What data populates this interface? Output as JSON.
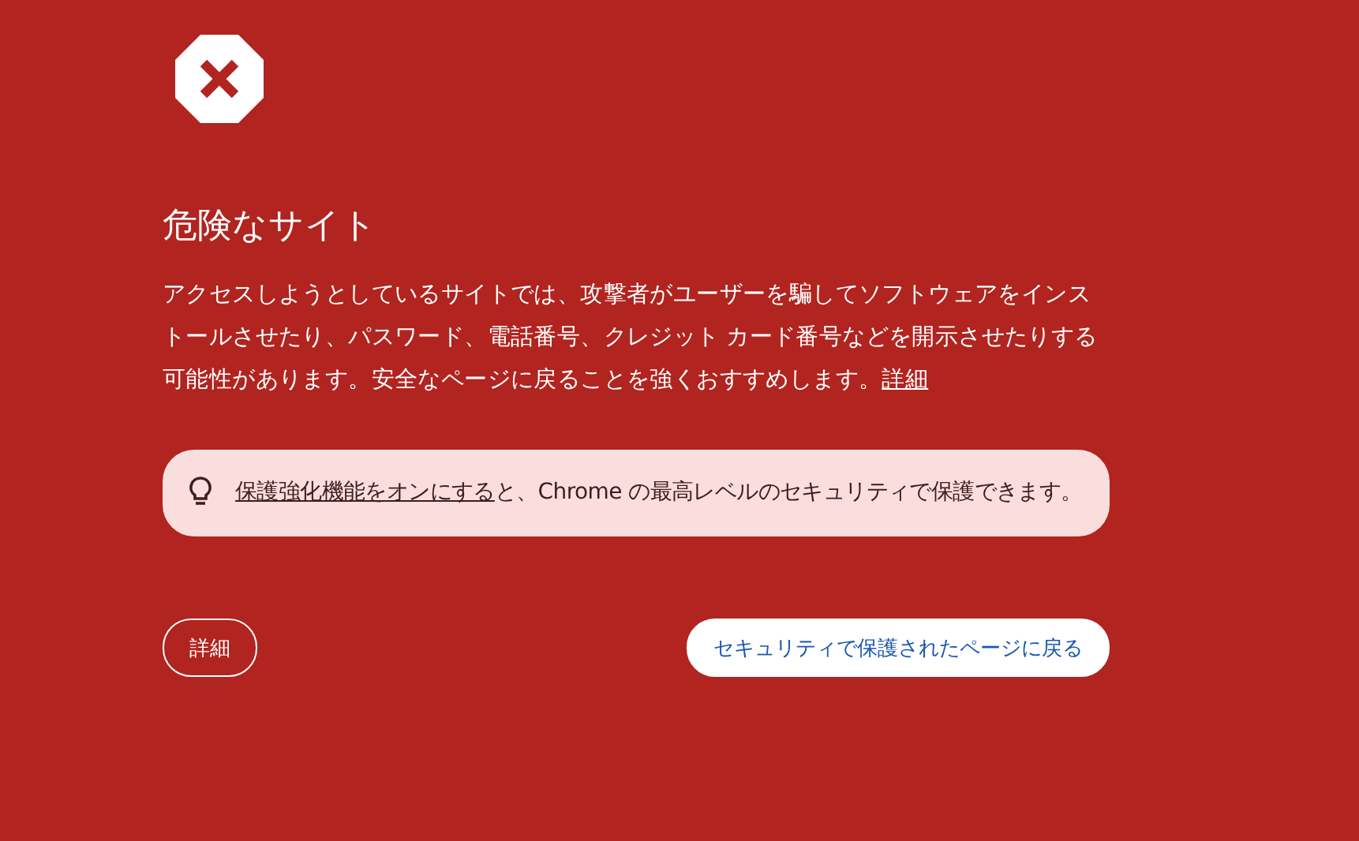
{
  "title": "危険なサイト",
  "description": {
    "text": "アクセスしようとしているサイトでは、攻撃者がユーザーを騙してソフトウェアをインストールさせたり、パスワード、電話番号、クレジット カード番号などを開示させたりする可能性があります。安全なページに戻ることを強くおすすめします。",
    "link": "詳細"
  },
  "tip": {
    "link": "保護強化機能をオンにする",
    "text": "と、Chrome の最高レベルのセキュリティで保護できます。"
  },
  "buttons": [
    {
      "label": "詳細",
      "kind": "secondary"
    },
    {
      "label": "セキュリティで保護されたページに戻る",
      "kind": "primary"
    }
  ]
}
